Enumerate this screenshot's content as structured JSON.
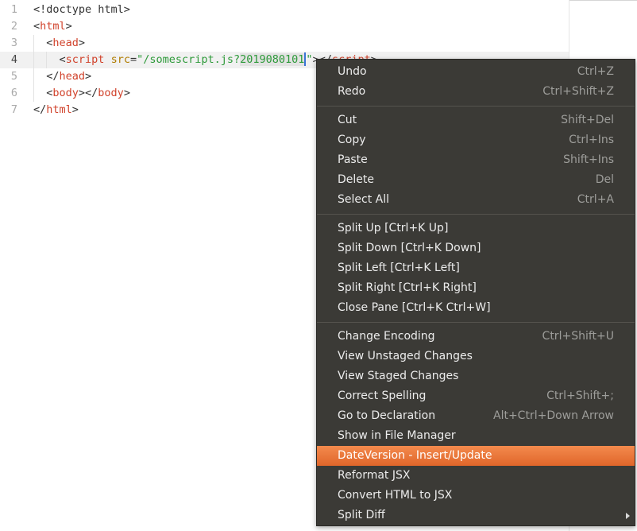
{
  "editor": {
    "lines": [
      {
        "num": "1",
        "parts": [
          {
            "t": "<!doctype html>"
          }
        ]
      },
      {
        "num": "2",
        "parts": [
          {
            "t": "<"
          },
          {
            "t": "html",
            "c": "tag"
          },
          {
            "t": ">"
          }
        ]
      },
      {
        "num": "3",
        "parts": [
          {
            "t": "  <"
          },
          {
            "t": "head",
            "c": "tag"
          },
          {
            "t": ">"
          }
        ]
      },
      {
        "num": "4",
        "cursor": true,
        "parts": [
          {
            "t": "    <"
          },
          {
            "t": "script",
            "c": "tag"
          },
          {
            "t": " "
          },
          {
            "t": "src",
            "c": "attr"
          },
          {
            "t": "="
          },
          {
            "t": "\"/somescript.js?",
            "c": "str"
          },
          {
            "t": "2019080101",
            "c": "str sel"
          },
          {
            "t": "",
            "caret": true
          },
          {
            "t": "\"",
            "c": "str"
          },
          {
            "t": "></"
          },
          {
            "t": "script",
            "c": "tag"
          },
          {
            "t": ">"
          }
        ]
      },
      {
        "num": "5",
        "parts": [
          {
            "t": "  </"
          },
          {
            "t": "head",
            "c": "tag"
          },
          {
            "t": ">"
          }
        ]
      },
      {
        "num": "6",
        "parts": [
          {
            "t": "  <"
          },
          {
            "t": "body",
            "c": "tag"
          },
          {
            "t": "></"
          },
          {
            "t": "body",
            "c": "tag"
          },
          {
            "t": ">"
          }
        ]
      },
      {
        "num": "7",
        "parts": [
          {
            "t": "</"
          },
          {
            "t": "html",
            "c": "tag"
          },
          {
            "t": ">"
          }
        ]
      }
    ]
  },
  "menu": {
    "groups": [
      [
        {
          "label": "Undo",
          "shortcut": "Ctrl+Z"
        },
        {
          "label": "Redo",
          "shortcut": "Ctrl+Shift+Z"
        }
      ],
      [
        {
          "label": "Cut",
          "shortcut": "Shift+Del"
        },
        {
          "label": "Copy",
          "shortcut": "Ctrl+Ins"
        },
        {
          "label": "Paste",
          "shortcut": "Shift+Ins"
        },
        {
          "label": "Delete",
          "shortcut": "Del"
        },
        {
          "label": "Select All",
          "shortcut": "Ctrl+A"
        }
      ],
      [
        {
          "label": "Split Up [Ctrl+K Up]",
          "shortcut": ""
        },
        {
          "label": "Split Down [Ctrl+K Down]",
          "shortcut": ""
        },
        {
          "label": "Split Left [Ctrl+K Left]",
          "shortcut": ""
        },
        {
          "label": "Split Right [Ctrl+K Right]",
          "shortcut": ""
        },
        {
          "label": "Close Pane [Ctrl+K Ctrl+W]",
          "shortcut": ""
        }
      ],
      [
        {
          "label": "Change Encoding",
          "shortcut": "Ctrl+Shift+U"
        },
        {
          "label": "View Unstaged Changes",
          "shortcut": ""
        },
        {
          "label": "View Staged Changes",
          "shortcut": ""
        },
        {
          "label": "Correct Spelling",
          "shortcut": "Ctrl+Shift+;"
        },
        {
          "label": "Go to Declaration",
          "shortcut": "Alt+Ctrl+Down Arrow"
        },
        {
          "label": "Show in File Manager",
          "shortcut": ""
        },
        {
          "label": "DateVersion - Insert/Update",
          "shortcut": "",
          "active": true
        },
        {
          "label": "Reformat JSX",
          "shortcut": ""
        },
        {
          "label": "Convert HTML to JSX",
          "shortcut": ""
        },
        {
          "label": "Split Diff",
          "shortcut": "",
          "submenu": true
        }
      ]
    ]
  },
  "colors": {
    "menu_background": "#3b3a36",
    "menu_highlight": "#e9733a",
    "tag": "#d1432c",
    "attribute": "#b07c00",
    "string": "#2e9a3a",
    "caret": "#3b74d6"
  }
}
